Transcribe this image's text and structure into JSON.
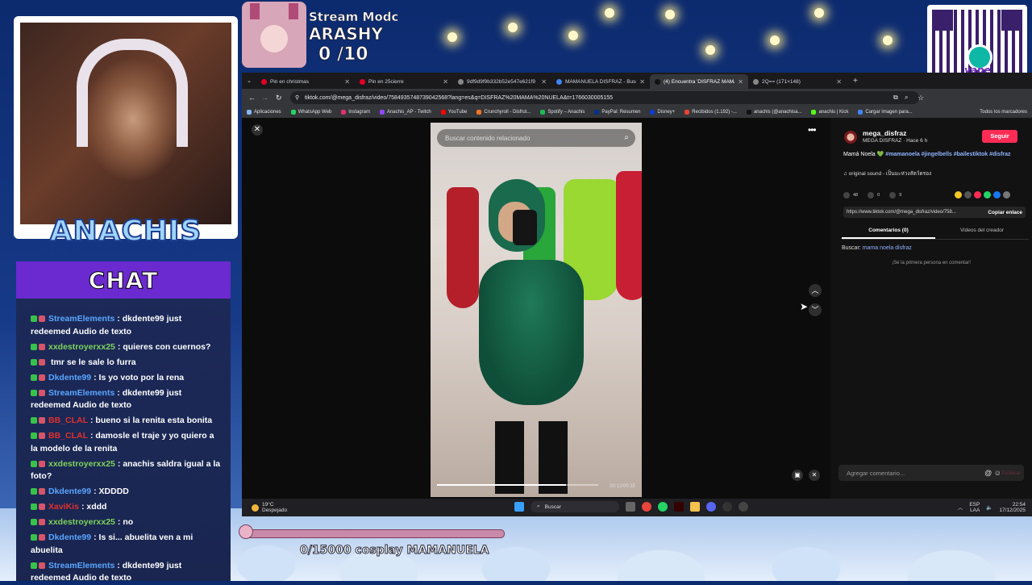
{
  "overlay": {
    "stream_mode": "Stream Modc",
    "username": "ARASHY",
    "counter": "0 /10",
    "cam_name": "ANACHIS",
    "qr_label": "yape",
    "goal_text": "0/15000 cosplay MAMANUELA",
    "goal_progress": 0
  },
  "chat": {
    "title": "CHAT",
    "messages": [
      {
        "user": "StreamElements",
        "user_color": "#5aa6ff",
        "text": ": dkdente99 just redeemed Audio de texto"
      },
      {
        "user": "xxdestroyerxx25",
        "user_color": "#7fd35a",
        "text": ": quieres con cuernos?"
      },
      {
        "user": "",
        "user_color": "#2a5bd8",
        "text": "tmr se le sale lo furra"
      },
      {
        "user": "Dkdente99",
        "user_color": "#5aa6ff",
        "text": ": Is yo voto por la rena"
      },
      {
        "user": "StreamElements",
        "user_color": "#5aa6ff",
        "text": ": dkdente99 just redeemed Audio de texto"
      },
      {
        "user": "BB_CLAL",
        "user_color": "#e0302f",
        "text": ": bueno si la renita esta bonita"
      },
      {
        "user": "BB_CLAL",
        "user_color": "#e0302f",
        "text": ": damosle el traje y yo quiero a la modelo de la renita"
      },
      {
        "user": "xxdestroyerxx25",
        "user_color": "#7fd35a",
        "text": ": anachis saldra igual a la foto?"
      },
      {
        "user": "Dkdente99",
        "user_color": "#5aa6ff",
        "text": ": XDDDD"
      },
      {
        "user": "XaviKis",
        "user_color": "#e0302f",
        "text": ": xddd"
      },
      {
        "user": "xxdestroyerxx25",
        "user_color": "#7fd35a",
        "text": ": no"
      },
      {
        "user": "Dkdente99",
        "user_color": "#5aa6ff",
        "text": ": Is si... abuelita ven a mi abuelita"
      },
      {
        "user": "StreamElements",
        "user_color": "#5aa6ff",
        "text": ": dkdente99 just redeemed Audio de texto"
      }
    ]
  },
  "browser": {
    "tabs": [
      {
        "label": "Pin en christmas",
        "fav_color": "#e60023",
        "active": false
      },
      {
        "label": "Pin en 25cierre",
        "fav_color": "#e60023",
        "active": false
      },
      {
        "label": "9df9d9f9b332b52e547e621f9",
        "fav_color": "#888888",
        "active": false
      },
      {
        "label": "MAMANUELA DISFRAZ - Busca",
        "fav_color": "#4285f4",
        "active": false
      },
      {
        "label": "(4) Encuentra 'DISFRAZ MAMA",
        "fav_color": "#111111",
        "active": true
      },
      {
        "label": "2Q== (171×148)",
        "fav_color": "#888888",
        "active": false
      }
    ],
    "new_tab": "+",
    "url": "tiktok.com/@mega_disfraz/video/7584935748739042568?lang=es&q=DISFRAZ%20MAMA%20NUELA&t=1766030005155",
    "bookmarks": [
      {
        "label": "Aplicaciones",
        "color": "#8ab4f8"
      },
      {
        "label": "WhatsApp Web",
        "color": "#25d366"
      },
      {
        "label": "Instagram",
        "color": "#e1306c"
      },
      {
        "label": "Anachis_AP - Twitch",
        "color": "#9146ff"
      },
      {
        "label": "YouTube",
        "color": "#ff0000"
      },
      {
        "label": "Crunchyroll - Disfrut...",
        "color": "#f47521"
      },
      {
        "label": "Spotify – Anachis",
        "color": "#1db954"
      },
      {
        "label": "PayPal: Resumen",
        "color": "#003087"
      },
      {
        "label": "Disney+",
        "color": "#113ccf"
      },
      {
        "label": "Recibidos (1.192) -...",
        "color": "#ea4335"
      },
      {
        "label": "anachis (@anachisa...",
        "color": "#111111"
      },
      {
        "label": "anachis | Kick",
        "color": "#53fc18"
      },
      {
        "label": "Cargar imagen para...",
        "color": "#4285f4"
      }
    ],
    "all_bookmarks": "Todos los marcadores"
  },
  "tiktok": {
    "search_placeholder": "Buscar contenido relacionado",
    "video_time": "00:12/00:15",
    "video_progress": 0.8,
    "author": "mega_disfraz",
    "author_sub": "MEGA DISFRAZ · Hace 6 h",
    "follow": "Seguir",
    "caption": "Mamá Noela 💚",
    "hashtags": "#mamanoela #jingelbells #bailestiktok #disfraz",
    "sound": "♫ original sound - เป็นมะห่วงสัตว์ดรอง",
    "likes": "48",
    "comments": "0",
    "saves": "9",
    "link": "https://www.tiktok.com/@mega_disfraz/video/758...",
    "copy_link": "Copiar enlace",
    "tab_comments": "Comentarios (0)",
    "tab_creator": "Videos del creador",
    "search_label": "Buscar:",
    "search_query": "mama noela disfraz",
    "empty_comments": "¡Sé la primera persona en comentar!",
    "comment_placeholder": "Agregar comentario...",
    "publish": "Publicar"
  },
  "taskbar": {
    "temperature": "19°C",
    "weather": "Despejado",
    "search": "Buscar",
    "language": "ESP",
    "layout": "LAA",
    "time": "22:54",
    "date": "17/12/2025"
  }
}
